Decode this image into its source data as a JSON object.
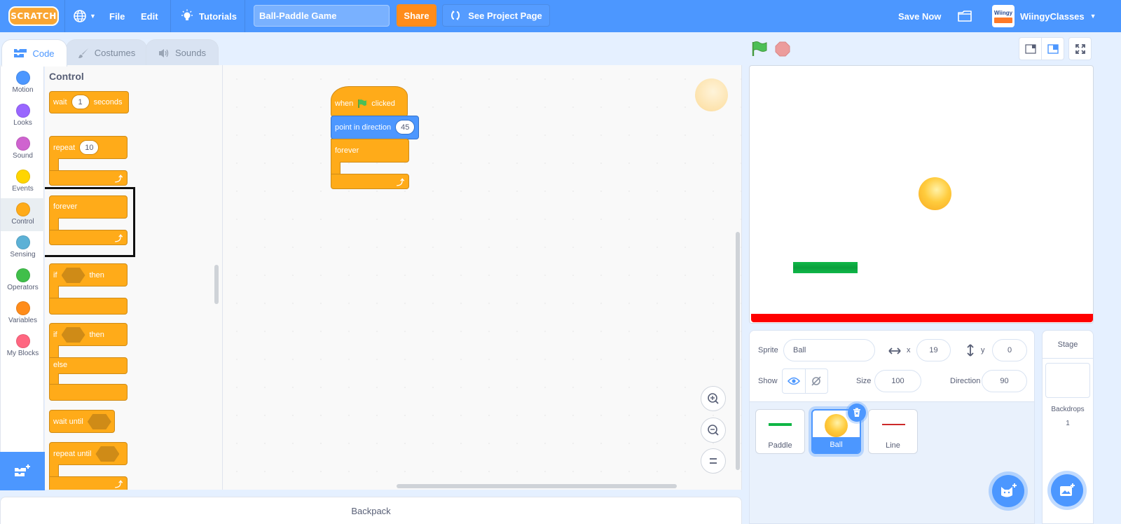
{
  "menubar": {
    "logo": "SCRATCH",
    "file": "File",
    "edit": "Edit",
    "tutorials": "Tutorials",
    "project_title": "Ball-Paddle Game",
    "share": "Share",
    "see_project_page": "See Project Page",
    "save_now": "Save Now",
    "username": "WiingyClasses",
    "avatar_text": "Wiingy"
  },
  "tabs": [
    {
      "label": "Code",
      "active": true
    },
    {
      "label": "Costumes",
      "active": false
    },
    {
      "label": "Sounds",
      "active": false
    }
  ],
  "categories": [
    {
      "label": "Motion",
      "color": "#4c97ff"
    },
    {
      "label": "Looks",
      "color": "#9966ff"
    },
    {
      "label": "Sound",
      "color": "#cf63cf"
    },
    {
      "label": "Events",
      "color": "#ffd500"
    },
    {
      "label": "Control",
      "color": "#ffab19",
      "selected": true
    },
    {
      "label": "Sensing",
      "color": "#5cb1d6"
    },
    {
      "label": "Operators",
      "color": "#40bf4a"
    },
    {
      "label": "Variables",
      "color": "#ff8c1a"
    },
    {
      "label": "My Blocks",
      "color": "#ff6680"
    }
  ],
  "palette": {
    "title": "Control",
    "blocks": {
      "wait": {
        "pre": "wait",
        "value": "1",
        "post": "seconds"
      },
      "repeat": {
        "pre": "repeat",
        "value": "10"
      },
      "forever": {
        "label": "forever"
      },
      "if_then": {
        "pre": "if",
        "post": "then"
      },
      "if_else": {
        "pre": "if",
        "post": "then",
        "else": "else"
      },
      "wait_until": {
        "label": "wait until"
      },
      "repeat_until": {
        "label": "repeat until"
      }
    }
  },
  "script": {
    "hat": {
      "pre": "when",
      "post": "clicked"
    },
    "point": {
      "label": "point in direction",
      "value": "45"
    },
    "forever": {
      "label": "forever"
    }
  },
  "backpack": "Backpack",
  "sprite_info": {
    "sprite_label": "Sprite",
    "sprite_name": "Ball",
    "x_label": "x",
    "x": "19",
    "y_label": "y",
    "y": "0",
    "show_label": "Show",
    "size_label": "Size",
    "size": "100",
    "direction_label": "Direction",
    "direction": "90"
  },
  "sprites": [
    {
      "name": "Paddle",
      "selected": false
    },
    {
      "name": "Ball",
      "selected": true
    },
    {
      "name": "Line",
      "selected": false
    }
  ],
  "stage_pane": {
    "title": "Stage",
    "backdrops_label": "Backdrops",
    "backdrops_count": "1"
  },
  "colors": {
    "accent": "#4c97ff",
    "control": "#ffab19",
    "motion": "#4c97ff",
    "share": "#ff8c1a",
    "paddle": "#0fb545",
    "line": "#ff0000"
  }
}
